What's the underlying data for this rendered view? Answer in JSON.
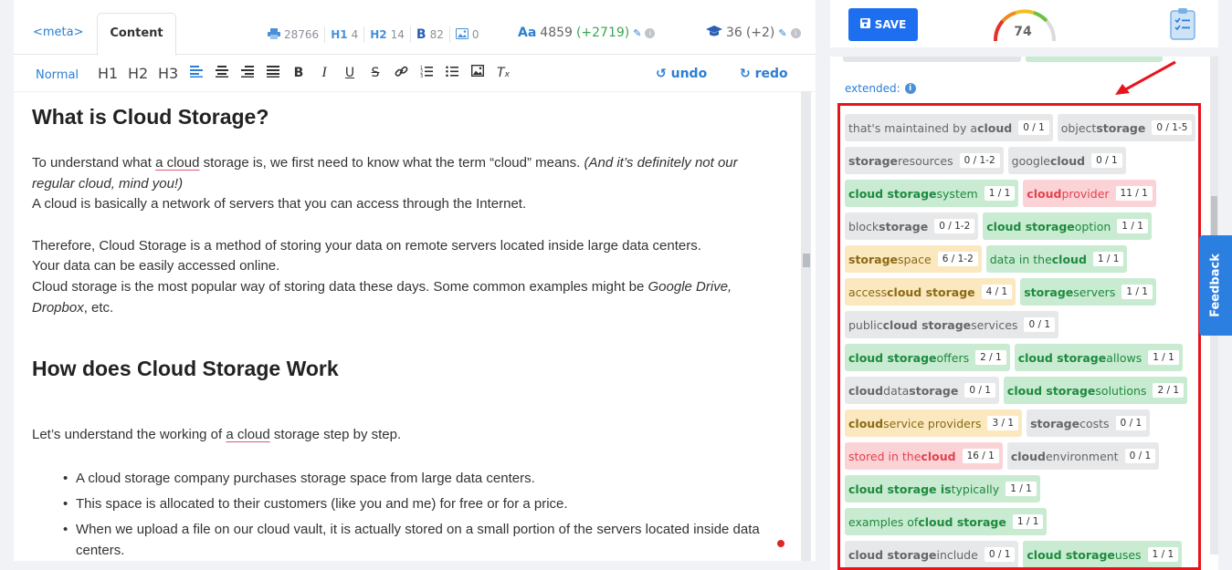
{
  "tabs": {
    "meta": "<meta>",
    "content": "Content"
  },
  "stats": [
    {
      "icon": "printer-icon",
      "label": "28766"
    },
    {
      "icon": "h1-icon",
      "iconText": "H1",
      "label": "4"
    },
    {
      "icon": "h2-icon",
      "iconText": "H2",
      "label": "14"
    },
    {
      "icon": "bold-icon",
      "iconText": "B",
      "label": "82"
    },
    {
      "icon": "image-icon",
      "label": "0"
    }
  ],
  "words": {
    "icon": "Aa",
    "count": "4859",
    "delta": "(+2719)"
  },
  "readability": {
    "value": "36",
    "delta": "(+2)"
  },
  "toolbar": {
    "format": "Normal",
    "h1": "H1",
    "h2": "H2",
    "h3": "H3",
    "undo": "undo",
    "redo": "redo"
  },
  "doc": {
    "h_what": "What is Cloud Storage?",
    "p1a": "To understand what ",
    "p1u": "a cloud",
    "p1b": " storage is, we first need to know what the term “cloud” means. ",
    "p1i": "(And it’s definitely not our regular cloud, mind you!)",
    "p2": "A cloud is basically a network of servers that you can access through the Internet.",
    "p3": "Therefore, Cloud Storage is a method of storing your data on remote servers located inside large data centers.",
    "p4": "Your data can be easily accessed online.",
    "p5a": "Cloud storage is the most popular way of storing data these days. Some common examples might be ",
    "p5i": "Google Drive, Dropbox",
    "p5b": ", etc.",
    "h_how": "How does Cloud Storage Work",
    "p6a": "Let’s understand the working of ",
    "p6u": "a cloud",
    "p6b": " storage step by step.",
    "bullets": [
      "A cloud storage company purchases storage space from large data centers.",
      "This space is allocated to their customers (like you and me) for free or for a price.",
      "When we upload a file on our cloud vault, it is actually stored on a small portion of the servers located inside data centers."
    ]
  },
  "right": {
    "save": "SAVE",
    "score": "74",
    "extended_label": "extended:",
    "feedback": "Feedback"
  },
  "chips": [
    {
      "parts": [
        [
          "that's maintained by a ",
          0
        ],
        [
          "cloud",
          1
        ]
      ],
      "count": "0 / 1",
      "color": "gray"
    },
    {
      "parts": [
        [
          "object ",
          0
        ],
        [
          "storage",
          1
        ]
      ],
      "count": "0 / 1-5",
      "color": "gray"
    },
    {
      "parts": [
        [
          "storage",
          1
        ],
        [
          " resources",
          0
        ]
      ],
      "count": "0 / 1-2",
      "color": "gray"
    },
    {
      "parts": [
        [
          "google ",
          0
        ],
        [
          "cloud",
          1
        ]
      ],
      "count": "0 / 1",
      "color": "gray"
    },
    {
      "parts": [
        [
          "cloud storage",
          1
        ],
        [
          " system",
          0
        ]
      ],
      "count": "1 / 1",
      "color": "green"
    },
    {
      "parts": [
        [
          "cloud",
          1
        ],
        [
          " provider",
          0
        ]
      ],
      "count": "11 / 1",
      "color": "red"
    },
    {
      "parts": [
        [
          "block ",
          0
        ],
        [
          "storage",
          1
        ]
      ],
      "count": "0 / 1-2",
      "color": "gray"
    },
    {
      "parts": [
        [
          "cloud storage",
          1
        ],
        [
          " option",
          0
        ]
      ],
      "count": "1 / 1",
      "color": "green"
    },
    {
      "parts": [
        [
          "storage",
          1
        ],
        [
          " space",
          0
        ]
      ],
      "count": "6 / 1-2",
      "color": "yellow"
    },
    {
      "parts": [
        [
          "data in the ",
          0
        ],
        [
          "cloud",
          1
        ]
      ],
      "count": "1 / 1",
      "color": "green"
    },
    {
      "parts": [
        [
          "access ",
          0
        ],
        [
          "cloud storage",
          1
        ]
      ],
      "count": "4 / 1",
      "color": "yellow"
    },
    {
      "parts": [
        [
          "storage",
          1
        ],
        [
          " servers",
          0
        ]
      ],
      "count": "1 / 1",
      "color": "green"
    },
    {
      "parts": [
        [
          "public ",
          0
        ],
        [
          "cloud storage",
          1
        ],
        [
          " services",
          0
        ]
      ],
      "count": "0 / 1",
      "color": "gray"
    },
    {
      "parts": [
        [
          "cloud storage",
          1
        ],
        [
          " offers",
          0
        ]
      ],
      "count": "2 / 1",
      "color": "green"
    },
    {
      "parts": [
        [
          "cloud storage",
          1
        ],
        [
          " allows",
          0
        ]
      ],
      "count": "1 / 1",
      "color": "green"
    },
    {
      "parts": [
        [
          "cloud",
          1
        ],
        [
          " data ",
          0
        ],
        [
          "storage",
          1
        ]
      ],
      "count": "0 / 1",
      "color": "gray"
    },
    {
      "parts": [
        [
          "cloud storage",
          1
        ],
        [
          " solutions",
          0
        ]
      ],
      "count": "2 / 1",
      "color": "green"
    },
    {
      "parts": [
        [
          "cloud",
          1
        ],
        [
          " service providers",
          0
        ]
      ],
      "count": "3 / 1",
      "color": "yellow"
    },
    {
      "parts": [
        [
          "storage",
          1
        ],
        [
          " costs",
          0
        ]
      ],
      "count": "0 / 1",
      "color": "gray"
    },
    {
      "parts": [
        [
          "stored in the ",
          0
        ],
        [
          "cloud",
          1
        ]
      ],
      "count": "16 / 1",
      "color": "red"
    },
    {
      "parts": [
        [
          "cloud",
          1
        ],
        [
          " environment",
          0
        ]
      ],
      "count": "0 / 1",
      "color": "gray"
    },
    {
      "parts": [
        [
          "cloud storage is",
          1
        ],
        [
          " typically",
          0
        ]
      ],
      "count": "1 / 1",
      "color": "green"
    },
    {
      "parts": [
        [
          "examples of ",
          0
        ],
        [
          "cloud storage",
          1
        ]
      ],
      "count": "1 / 1",
      "color": "green"
    },
    {
      "parts": [
        [
          "cloud storage",
          1
        ],
        [
          " include",
          0
        ]
      ],
      "count": "0 / 1",
      "color": "gray"
    },
    {
      "parts": [
        [
          "cloud storage",
          1
        ],
        [
          " uses",
          0
        ]
      ],
      "count": "1 / 1",
      "color": "green"
    }
  ]
}
